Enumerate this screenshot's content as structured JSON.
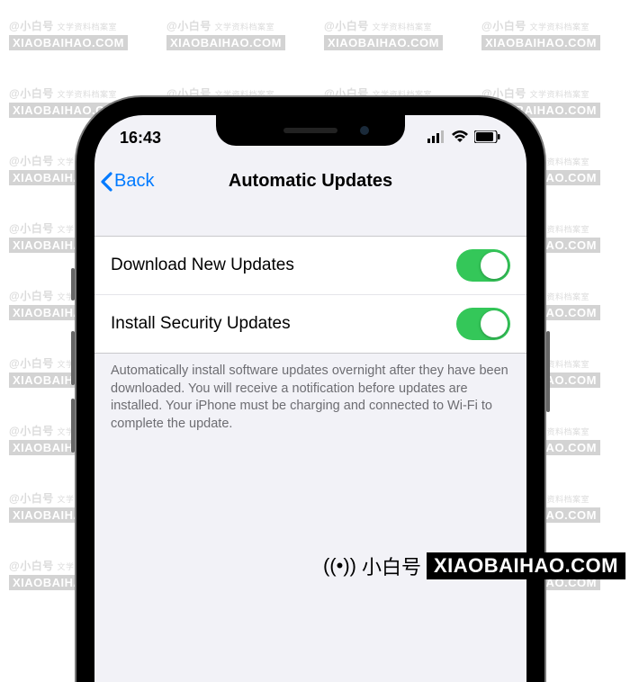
{
  "watermark": {
    "brand": "@小白号",
    "tagline": "文学资料档案室",
    "url": "XIAOBAIHAO.COM",
    "corner_brand": "小白号"
  },
  "statusbar": {
    "time": "16:43"
  },
  "navbar": {
    "back_label": "Back",
    "title": "Automatic Updates"
  },
  "settings": {
    "rows": [
      {
        "label": "Download New Updates",
        "on": true
      },
      {
        "label": "Install Security Updates",
        "on": true
      }
    ],
    "footer": "Automatically install software updates overnight after they have been downloaded. You will receive a notification before updates are installed. Your iPhone must be charging and connected to Wi-Fi to complete the update."
  }
}
